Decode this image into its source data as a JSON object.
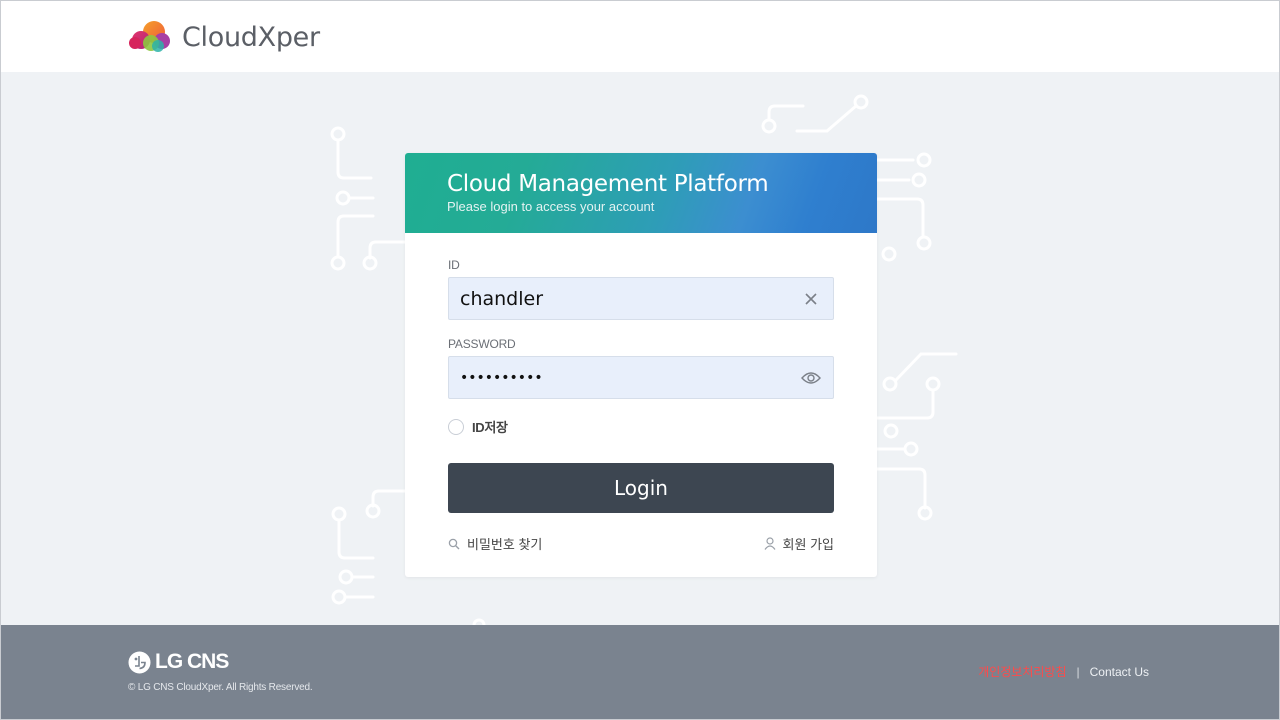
{
  "header": {
    "brand": "CloudXper"
  },
  "login_card": {
    "title": "Cloud Management Platform",
    "subtitle": "Please login to access your account",
    "id_label": "ID",
    "id_value": "chandler",
    "password_label": "PASSWORD",
    "password_value": "••••••••••",
    "save_id_label": "ID저장",
    "login_label": "Login",
    "find_password_label": "비밀번호 찾기",
    "signup_label": "회원 가입",
    "icons": {
      "clear": "close-icon",
      "show_password": "eye-icon",
      "search": "search-icon",
      "user": "user-icon"
    }
  },
  "footer": {
    "company_logo": "LG CNS",
    "copyright": "© LG CNS CloudXper. All Rights Reserved.",
    "privacy_link": "개인정보처리방침",
    "separator": "|",
    "contact_link": "Contact Us"
  },
  "colors": {
    "page_bg": "#eff2f5",
    "header_grad_start": "#1fae92",
    "header_grad_end": "#2e78c8",
    "button": "#3d4651",
    "footer_bg": "#7a838f",
    "privacy": "#ff4a4a"
  }
}
